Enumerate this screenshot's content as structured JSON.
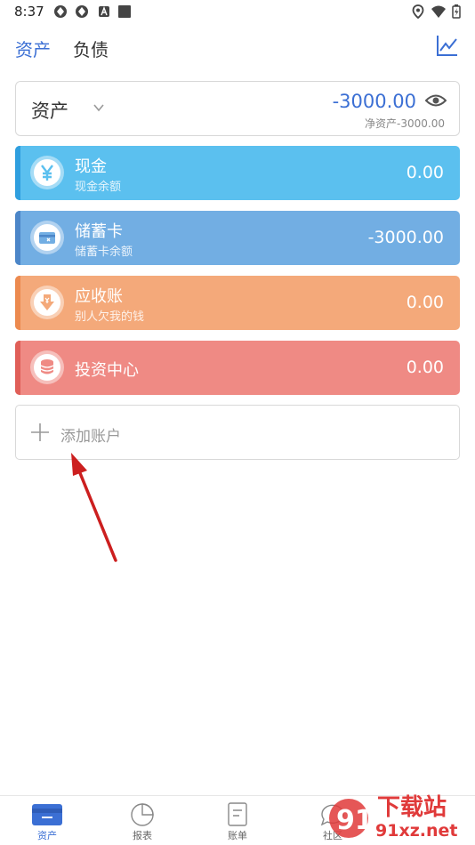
{
  "status_bar": {
    "time": "8:37"
  },
  "header": {
    "tabs": [
      {
        "label": "资产",
        "active": true
      },
      {
        "label": "负债",
        "active": false
      }
    ]
  },
  "summary": {
    "title": "资产",
    "amount": "-3000.00",
    "net_label": "净资产-3000.00"
  },
  "accounts": [
    {
      "name": "现金",
      "sub": "现金余额",
      "amount": "0.00",
      "color": "#5bc0ef",
      "stripe": "#2f9fdf",
      "icon": "yuan-icon"
    },
    {
      "name": "储蓄卡",
      "sub": "储蓄卡余额",
      "amount": "-3000.00",
      "color": "#72aee3",
      "stripe": "#4c86c8",
      "icon": "card-icon"
    },
    {
      "name": "应收账",
      "sub": "别人欠我的钱",
      "amount": "0.00",
      "color": "#f4a97a",
      "stripe": "#ec8a4f",
      "icon": "receivable-icon"
    },
    {
      "name": "投资中心",
      "sub": "",
      "amount": "0.00",
      "color": "#ef8a84",
      "stripe": "#e05f58",
      "icon": "coins-icon"
    }
  ],
  "add_account": {
    "label": "添加账户"
  },
  "bottom_nav": [
    {
      "label": "资产",
      "active": true
    },
    {
      "label": "报表",
      "active": false
    },
    {
      "label": "账单",
      "active": false
    },
    {
      "label": "社区",
      "active": false
    }
  ],
  "watermark": {
    "text_top": "下载站",
    "text_bottom": "91xz.net"
  },
  "colors": {
    "accent": "#3b6fd4",
    "arrow": "#cc1f1f"
  }
}
